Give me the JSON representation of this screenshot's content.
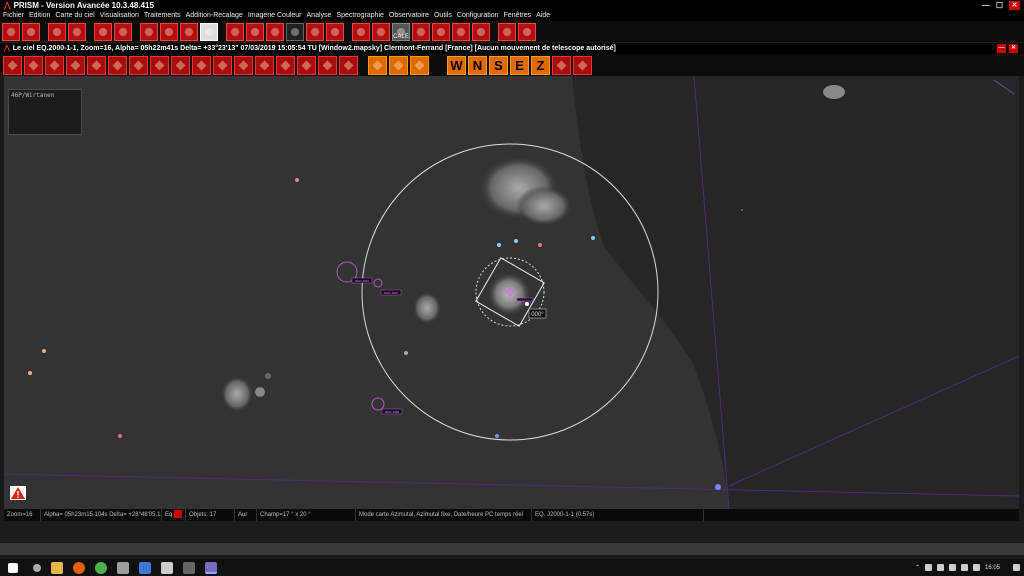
{
  "app": {
    "title": "PRISM - Version Avancée  10.3.48.415",
    "min": "—",
    "max": "☐",
    "close": "✕"
  },
  "menu": [
    "Fichier",
    "Edition",
    "Carte du ciel",
    "Visualisation",
    "Traitements",
    "Addition-Recalage",
    "Imagerie Couleur",
    "Analyse",
    "Spectrographie",
    "Observatoire",
    "Outils",
    "Configuration",
    "Fenêtres",
    "Aide"
  ],
  "toolbar1": {
    "icons": [
      "open-folder-icon",
      "save-icon",
      "print-icon",
      "info-icon",
      "draw-icon",
      "draw2-icon",
      "contrast-icon",
      "pen-icon",
      "tools-icon",
      "image-icon",
      "spectro-icon",
      "cloud-icon",
      "star-icon",
      "telescope-icon",
      "dome-icon",
      "observer-icon",
      "filter-icon",
      "calendar-icon",
      "moon-icon",
      "sun-icon",
      "export-icon",
      "cube-icon",
      "chart-icon",
      "hand-icon",
      "help-icon"
    ],
    "calendar_label": "CALE"
  },
  "document": {
    "title": "Le ciel EQ.2000-1-1, Zoom=16, Alpha= 05h22m41s Delta= +33°23'13\"    07/03/2019 15:05:54 TU [Window2.mapsky]   Clermont-Ferrand [France] [Aucun mouvement de telescope autorisé]"
  },
  "toolbar2": {
    "icons": [
      "zoom-in-icon",
      "zoom-out-icon",
      "planet-icon",
      "flag-icon",
      "galaxy-icon",
      "no-icon",
      "printer-icon",
      "brush-icon",
      "cross-icon",
      "fire-icon",
      "starburst-icon",
      "lightning-icon",
      "arrow-icon",
      "grid-icon",
      "new-icon",
      "stars-icon",
      "crosshair-icon",
      "rotate-icon",
      "line-icon",
      "triangle-icon"
    ],
    "directions": [
      "W",
      "N",
      "S",
      "E",
      "Z"
    ]
  },
  "sky": {
    "label_box": "46P/Wirtanen",
    "angle_label": "000°",
    "catalog_labels": [
      "NGC 1931",
      "NGC 1907",
      "NGC 1960"
    ],
    "colors": {
      "background": "#333333",
      "milkyway": "#262626",
      "grid_line": "#4a2f7a",
      "circle": "#dddddd",
      "marker": "#b05cc0"
    }
  },
  "status": {
    "zoom": "Zoom=16",
    "coords": "Alpha= 05h23m15.104s Delta= +28°48'05.12\"",
    "eq": "Eq",
    "objects": "Objets: 17",
    "aur": "Aur",
    "champ": "Champ=17 ° x 20 °",
    "mode": "Mode carte Azimutal, Azimutal fixe, Date/heure PC temps réel",
    "epoch": "EQ. J2000-1-1 (0.57s)"
  },
  "taskbar": {
    "icons": [
      "windows-start-icon",
      "search-icon",
      "explorer-icon",
      "firefox-icon",
      "chrome-icon",
      "gear-icon",
      "shield-icon",
      "app-icon",
      "calculator-icon",
      "prism-icon"
    ],
    "icon_colors": [
      "#ffffff",
      "#aaaaaa",
      "#e8b84a",
      "#e66000",
      "#4caf50",
      "#9e9e9e",
      "#3b7bd4",
      "#cccccc",
      "#666666",
      "#7a6bbf"
    ],
    "time": "16:05"
  }
}
